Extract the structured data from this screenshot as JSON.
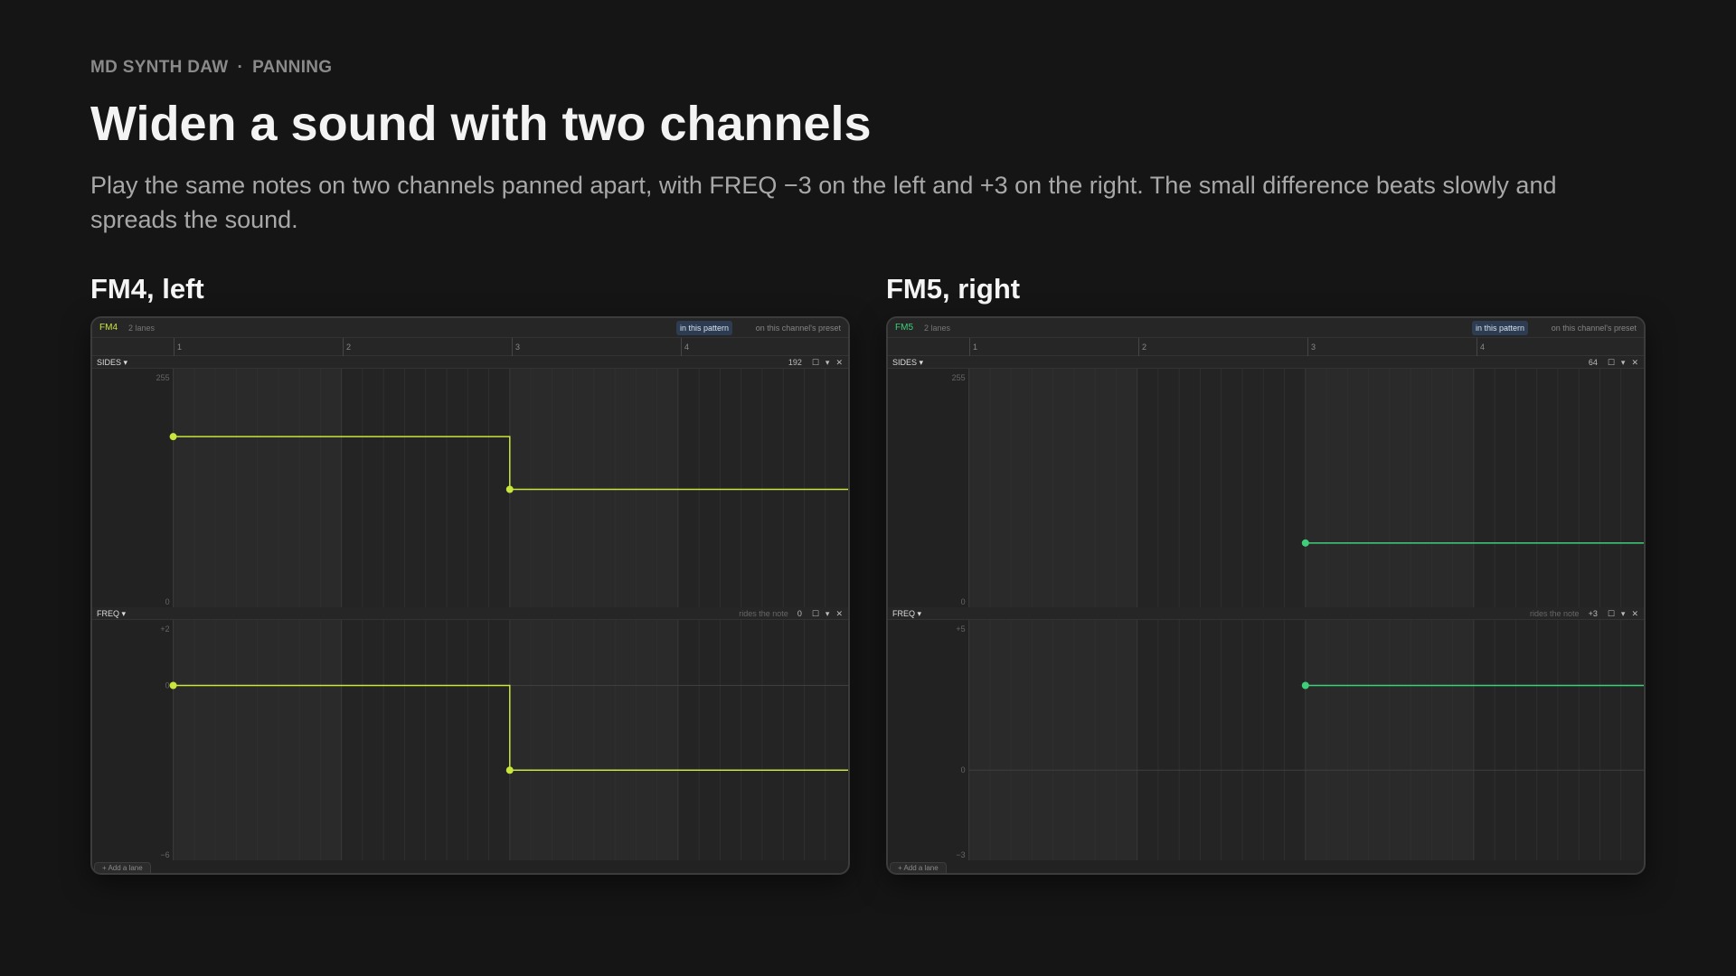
{
  "header": {
    "app": "MD SYNTH DAW",
    "separator": "·",
    "section": "PANNING",
    "title": "Widen a sound with two channels",
    "subtitle": "Play the same notes on two channels panned apart, with FREQ −3 on the left and +3 on the right. The small difference beats slowly and spreads the sound."
  },
  "panels": [
    {
      "heading": "FM4, left",
      "channel": "FM4",
      "channel_color": "#c8e63c",
      "lanes_count": "2 lanes",
      "scope_active": "in this pattern",
      "scope_other": "on this channel's preset",
      "ruler": [
        "1",
        "2",
        "3",
        "4"
      ],
      "add_lane": "+ Add a lane",
      "lanes": [
        {
          "name": "SIDES ▾",
          "rides": "",
          "value": "192",
          "axis_top": "255",
          "axis_mid": "",
          "axis_bottom": "0",
          "min": 0,
          "max": 255,
          "zero_line": null,
          "points": [
            {
              "beat": 1,
              "value": 188
            },
            {
              "beat": 3,
              "value": 128
            }
          ]
        },
        {
          "name": "FREQ ▾",
          "rides": "rides the note",
          "value": "0",
          "axis_top": "+2",
          "axis_mid": "0",
          "axis_bottom": "−6",
          "min": -6,
          "max": 2,
          "zero_line": 0,
          "points": [
            {
              "beat": 1,
              "value": 0
            },
            {
              "beat": 3,
              "value": -3
            }
          ]
        }
      ]
    },
    {
      "heading": "FM5, right",
      "channel": "FM5",
      "channel_color": "#3ecf7a",
      "lanes_count": "2 lanes",
      "scope_active": "in this pattern",
      "scope_other": "on this channel's preset",
      "ruler": [
        "1",
        "2",
        "3",
        "4"
      ],
      "add_lane": "+ Add a lane",
      "lanes": [
        {
          "name": "SIDES ▾",
          "rides": "",
          "value": "64",
          "axis_top": "255",
          "axis_mid": "",
          "axis_bottom": "0",
          "min": 0,
          "max": 255,
          "zero_line": null,
          "points": [
            {
              "beat": 3,
              "value": 67
            }
          ]
        },
        {
          "name": "FREQ ▾",
          "rides": "rides the note",
          "value": "+3",
          "axis_top": "+5",
          "axis_mid": "0",
          "axis_bottom": "−3",
          "min": -3,
          "max": 5,
          "zero_line": 0,
          "points": [
            {
              "beat": 3,
              "value": 3
            }
          ]
        }
      ]
    }
  ]
}
